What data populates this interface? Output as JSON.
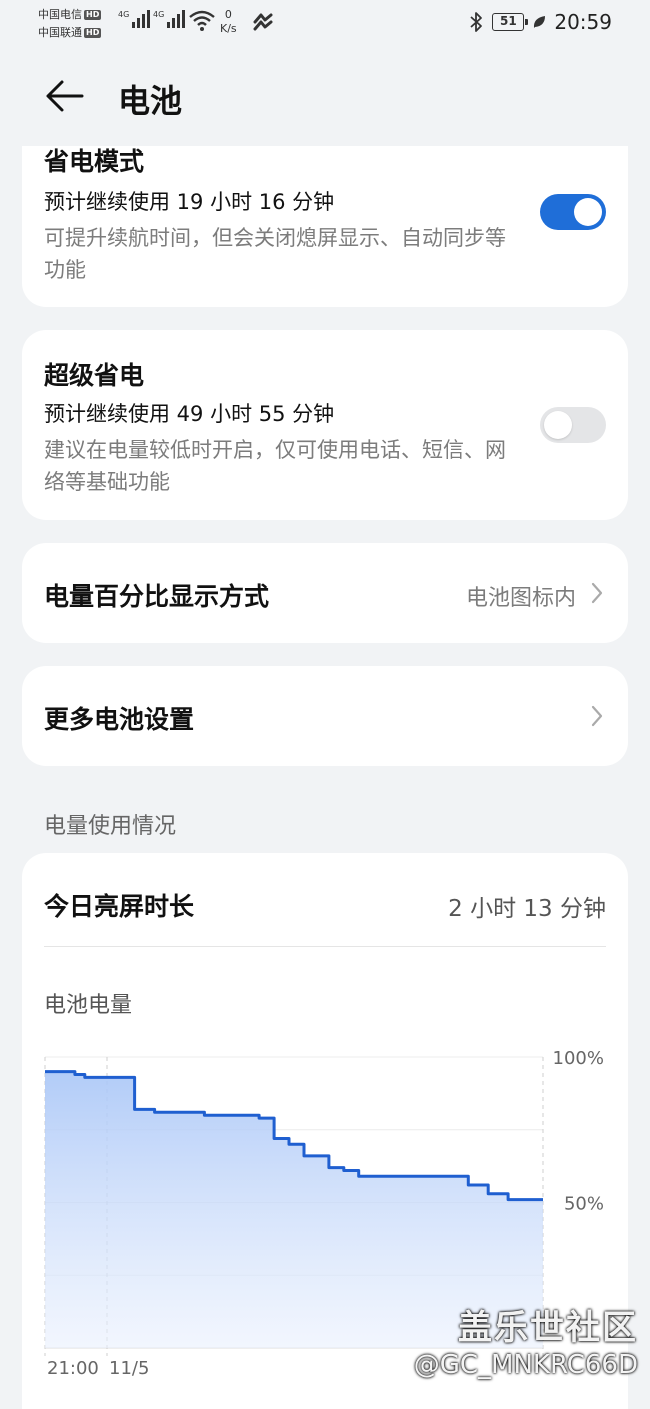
{
  "status_bar": {
    "carrier1": "中国电信",
    "carrier2": "中国联通",
    "hd": "HD",
    "network1": "4G",
    "network2": "4G",
    "speed_value": "0",
    "speed_unit": "K/s",
    "battery_level": "51",
    "time": "20:59"
  },
  "header": {
    "title": "电池"
  },
  "power_saving": {
    "title": "省电模式",
    "estimate": "预计继续使用 19 小时 16 分钟",
    "description": "可提升续航时间，但会关闭熄屏显示、自动同步等功能",
    "enabled": true
  },
  "super_saving": {
    "title": "超级省电",
    "estimate": "预计继续使用 49 小时 55 分钟",
    "description": "建议在电量较低时开启，仅可使用电话、短信、网络等基础功能",
    "enabled": false
  },
  "percentage_display": {
    "label": "电量百分比显示方式",
    "value": "电池图标内"
  },
  "more_settings": {
    "label": "更多电池设置"
  },
  "usage_section": {
    "label": "电量使用情况"
  },
  "screen_time": {
    "label": "今日亮屏时长",
    "value": "2 小时 13 分钟"
  },
  "battery_chart": {
    "label": "电池电量"
  },
  "chart_data": {
    "type": "area",
    "title": "电池电量",
    "x_labels": [
      "21:00",
      "11/5"
    ],
    "y_ticks": [
      "100%",
      "50%"
    ],
    "ylim": [
      0,
      100
    ],
    "grid": true,
    "x": [
      0,
      0.04,
      0.06,
      0.08,
      0.14,
      0.18,
      0.22,
      0.27,
      0.32,
      0.38,
      0.43,
      0.46,
      0.49,
      0.52,
      0.57,
      0.6,
      0.63,
      0.68,
      0.72,
      0.76,
      0.81,
      0.85,
      0.89,
      0.93,
      0.97,
      1.0
    ],
    "values": [
      95,
      95,
      94,
      93,
      93,
      82,
      81,
      81,
      80,
      80,
      79,
      72,
      70,
      66,
      62,
      61,
      59,
      59,
      59,
      59,
      59,
      56,
      53,
      51,
      51,
      51
    ],
    "color": "#1f5fd0"
  },
  "watermark": {
    "line1": "盖乐世社区",
    "line2": "@GC_MNKRC66D"
  }
}
